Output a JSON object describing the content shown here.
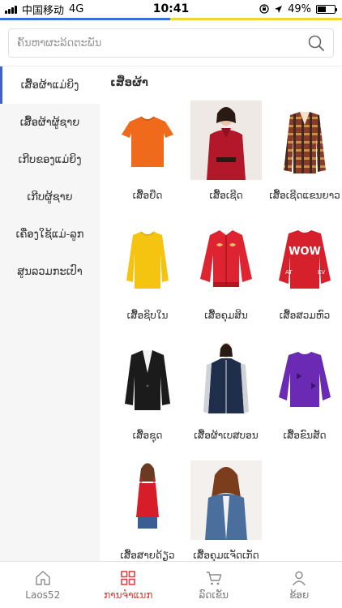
{
  "status_bar": {
    "carrier": "中国移动",
    "network": "4G",
    "time": "10:41",
    "battery_text": "49%",
    "battery_level": 0.49
  },
  "search": {
    "placeholder": "ຄົ້ນຫາຜະລິດຕະພັນ"
  },
  "sidebar": {
    "items": [
      {
        "label": "ເສື້ອຜ້າແມ່ຍິງ",
        "active": true
      },
      {
        "label": "ເສື້ອຜ້າຜູ້ຊາຍ",
        "active": false
      },
      {
        "label": "ເກີບຂອງແມ່ຍິງ",
        "active": false
      },
      {
        "label": "ເກີບຜູ້ຊາຍ",
        "active": false
      },
      {
        "label": "ເຄື່ອງໃຊ້ແມ່-ລູກ",
        "active": false
      },
      {
        "label": "ສູນລວມກະເປົາ",
        "active": false
      }
    ]
  },
  "content": {
    "section_title": "ເສື້ອຜ້າ",
    "products": [
      {
        "label": "ເສື້ອຍືດ",
        "icon": "orange-tshirt-icon"
      },
      {
        "label": "ເສື້ອເຊີດ",
        "icon": "red-blouse-icon"
      },
      {
        "label": "ເສື້ອເຊີດແຂນຍາວ",
        "icon": "plaid-shirt-icon"
      },
      {
        "label": "ເສື້ອຊິບໃນ",
        "icon": "yellow-sweater-icon"
      },
      {
        "label": "ເສື້ອຄຸມສິນ",
        "icon": "red-bomber-icon"
      },
      {
        "label": "ເສື້ອສວມຫົວ",
        "icon": "red-pullover-icon"
      },
      {
        "label": "ເສື້ອຊຸດ",
        "icon": "black-suit-icon"
      },
      {
        "label": "ເສື້ອຜ້າເບສບອນ",
        "icon": "baseball-jacket-icon"
      },
      {
        "label": "ເສື້ອຂົນສັດ",
        "icon": "purple-sweater-icon"
      },
      {
        "label": "ເສື້ອສາຍດ້ຽວ",
        "icon": "red-camisole-icon"
      },
      {
        "label": "ເສື້ອຄຸມແຈັດເກັດ",
        "icon": "denim-jacket-icon"
      }
    ]
  },
  "tabbar": {
    "tabs": [
      {
        "label": "Laos52",
        "icon": "home-icon",
        "active": false
      },
      {
        "label": "ການຈຳແນກ",
        "icon": "category-grid-icon",
        "active": true
      },
      {
        "label": "ລົດເຂັນ",
        "icon": "cart-icon",
        "active": false
      },
      {
        "label": "ຂ້ອຍ",
        "icon": "user-icon",
        "active": false
      }
    ]
  },
  "colors": {
    "accent_blue": "#3b63c8",
    "tab_active": "#e03a3a",
    "sidebar_bg": "#f6f6f6"
  }
}
